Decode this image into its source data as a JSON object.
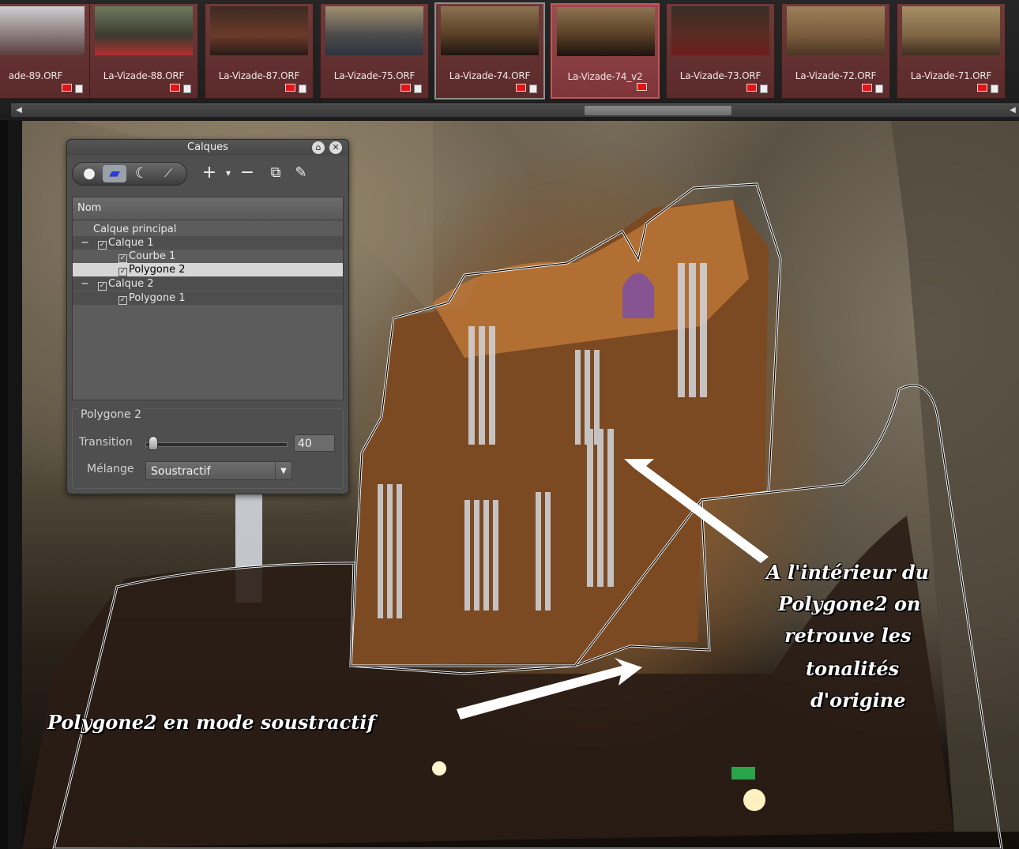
{
  "filmstrip": {
    "thumbnails": [
      {
        "label": "ade-89.ORF"
      },
      {
        "label": "La-Vizade-88.ORF"
      },
      {
        "label": "La-Vizade-87.ORF"
      },
      {
        "label": "La-Vizade-75.ORF"
      },
      {
        "label": "La-Vizade-74.ORF"
      },
      {
        "label": "La-Vizade-74_v2"
      },
      {
        "label": "La-Vizade-73.ORF"
      },
      {
        "label": "La-Vizade-72.ORF"
      },
      {
        "label": "La-Vizade-71.ORF"
      }
    ],
    "flag_color": "#e01515"
  },
  "layers_panel": {
    "title": "Calques",
    "tools": {
      "shape_tools": [
        "circle-tool-icon",
        "polygon-tool-icon",
        "curve-tool-icon",
        "brush-tool-icon"
      ],
      "actions": [
        "add-icon",
        "dropdown-icon",
        "remove-icon",
        "duplicate-layer-icon",
        "edit-icon"
      ]
    },
    "tree": {
      "header": "Nom",
      "rows": [
        {
          "label": "Calque principal"
        },
        {
          "label": "Calque 1"
        },
        {
          "label": "Courbe 1"
        },
        {
          "label": "Polygone 2"
        },
        {
          "label": "Calque 2"
        },
        {
          "label": "Polygone 1"
        }
      ],
      "expand_open": "−",
      "expand_closed": "−"
    },
    "properties": {
      "title": "Polygone 2",
      "transition_label": "Transition",
      "transition_value": "40",
      "blend_label": "Mélange",
      "blend_value": "Soustractif"
    }
  },
  "annotations": {
    "right_lines": [
      "A l'intérieur du",
      "Polygone2 on",
      "retrouve les",
      "tonalités",
      "d'origine"
    ],
    "bottom": "Polygone2 en mode soustractif"
  },
  "colors": {
    "panel_bg": "#4f4f4f",
    "selection_row": "#d6d6d6",
    "thumb_bg": "#6f3a3a",
    "thumb_current": "#9b4b4f"
  }
}
